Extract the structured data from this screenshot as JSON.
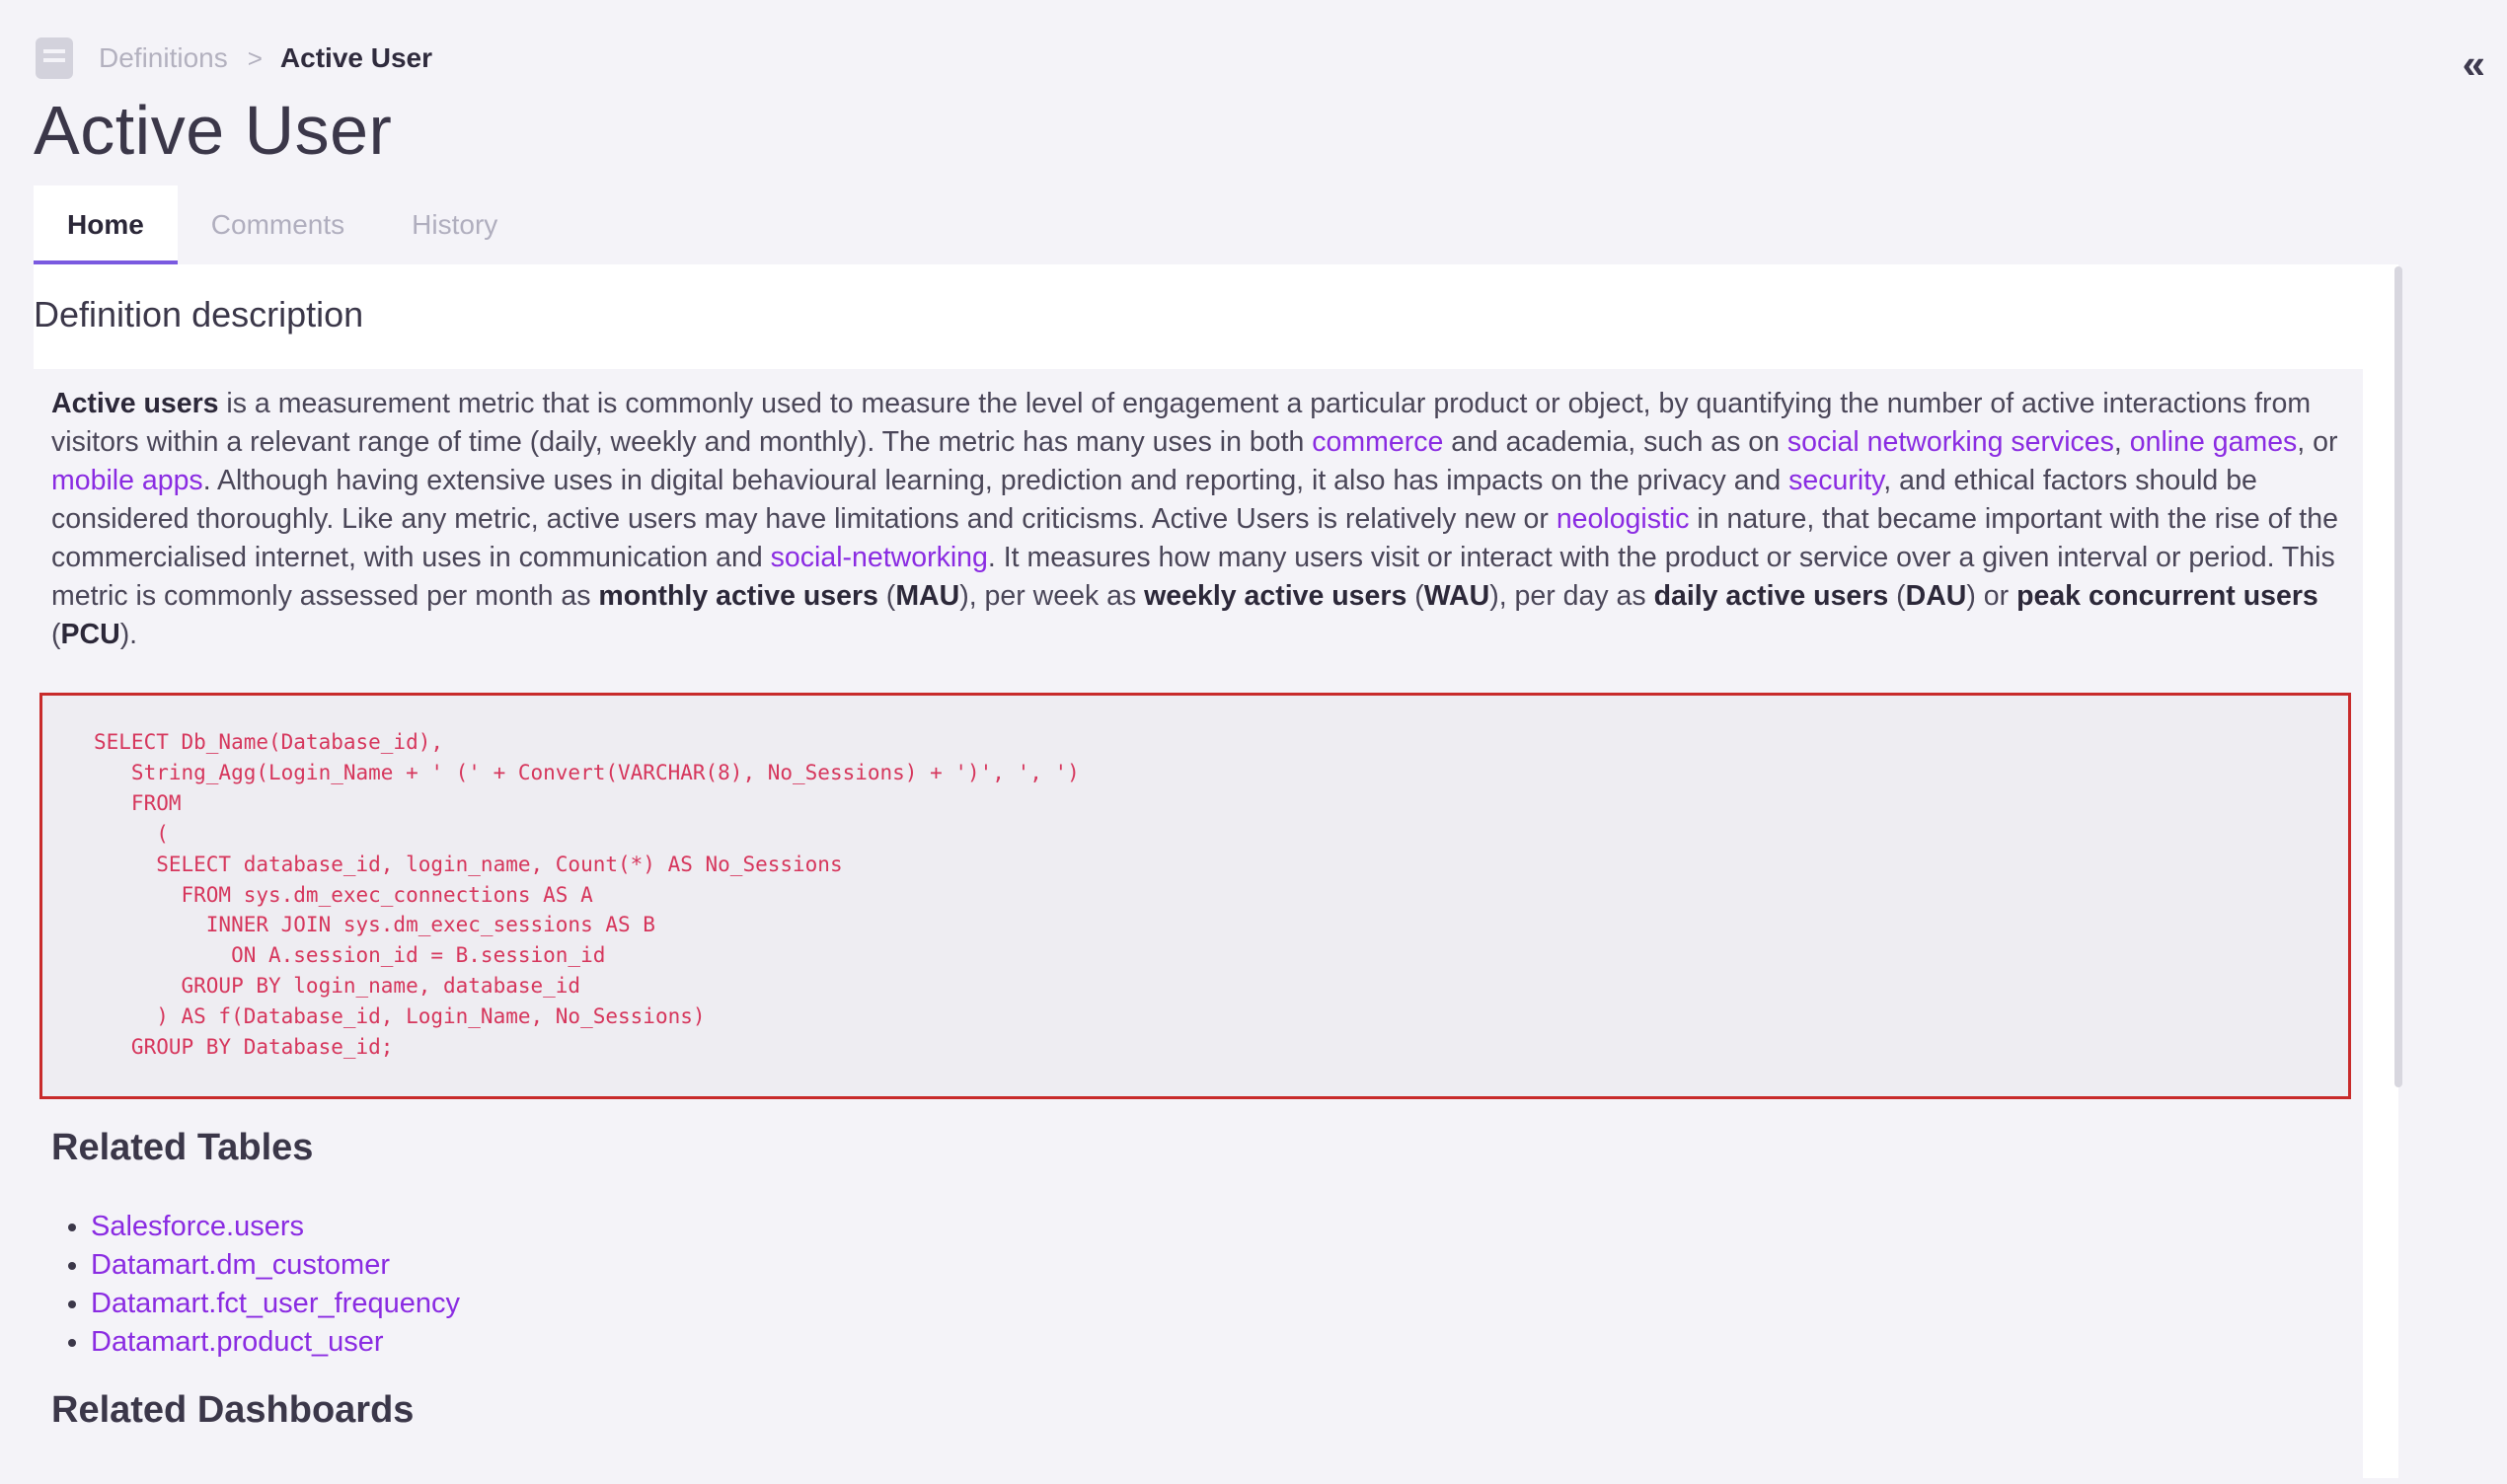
{
  "breadcrumb": {
    "parent": "Definitions",
    "separator": ">",
    "current": "Active User"
  },
  "icons": {
    "breadcrumb": "document-icon",
    "collapse": "collapse-double-chevron-left-icon"
  },
  "collapse_glyph": "«",
  "page_title": "Active User",
  "tabs": [
    {
      "label": "Home",
      "active": true
    },
    {
      "label": "Comments",
      "active": false
    },
    {
      "label": "History",
      "active": false
    }
  ],
  "section_title": "Definition description",
  "description": [
    {
      "t": "Active users",
      "s": "b"
    },
    {
      "t": " is a measurement metric that is commonly used to measure the level of engagement a particular product or object, by quantifying the number of active interactions from visitors within a relevant range of time (daily, weekly and monthly). The metric has many uses in both "
    },
    {
      "t": "commerce",
      "s": "a"
    },
    {
      "t": " and academia, such as on "
    },
    {
      "t": "social networking services",
      "s": "a"
    },
    {
      "t": ", "
    },
    {
      "t": "online games",
      "s": "a"
    },
    {
      "t": ", or "
    },
    {
      "t": "mobile apps",
      "s": "a"
    },
    {
      "t": ". Although having extensive uses in digital behavioural learning, prediction and reporting, it also has impacts on the privacy and "
    },
    {
      "t": "security",
      "s": "a"
    },
    {
      "t": ", and ethical factors should be considered thoroughly. Like any metric, active users may have limitations and criticisms. Active Users is relatively new or "
    },
    {
      "t": "neologistic",
      "s": "a"
    },
    {
      "t": " in nature, that became important with the rise of the commercialised internet, with uses in communication and "
    },
    {
      "t": "social-networking",
      "s": "a"
    },
    {
      "t": ". It measures how many users visit or interact with the product or service over a given interval or period. This metric is commonly assessed per month as "
    },
    {
      "t": "monthly active users",
      "s": "b"
    },
    {
      "t": " ("
    },
    {
      "t": "MAU",
      "s": "b"
    },
    {
      "t": "), per week as "
    },
    {
      "t": "weekly active users",
      "s": "b"
    },
    {
      "t": " ("
    },
    {
      "t": "WAU",
      "s": "b"
    },
    {
      "t": "), per day as "
    },
    {
      "t": "daily active users",
      "s": "b"
    },
    {
      "t": " ("
    },
    {
      "t": "DAU",
      "s": "b"
    },
    {
      "t": ") or "
    },
    {
      "t": "peak concurrent users",
      "s": "b"
    },
    {
      "t": " ("
    },
    {
      "t": "PCU",
      "s": "b"
    },
    {
      "t": ")."
    }
  ],
  "sql_code": "SELECT Db_Name(Database_id),\n   String_Agg(Login_Name + ' (' + Convert(VARCHAR(8), No_Sessions) + ')', ', ')\n   FROM\n     (\n     SELECT database_id, login_name, Count(*) AS No_Sessions\n       FROM sys.dm_exec_connections AS A\n         INNER JOIN sys.dm_exec_sessions AS B\n           ON A.session_id = B.session_id\n       GROUP BY login_name, database_id\n     ) AS f(Database_id, Login_Name, No_Sessions)\n   GROUP BY Database_id;",
  "related_tables": {
    "title": "Related Tables",
    "items": [
      "Salesforce.users",
      "Datamart.dm_customer",
      "Datamart.fct_user_frequency",
      "Datamart.product_user"
    ]
  },
  "related_dashboards": {
    "title": "Related Dashboards"
  },
  "colors": {
    "link": "#8a2be2",
    "tab_indicator": "#7a5ae0",
    "code_text": "#d6365c",
    "code_border": "#c82b2b"
  }
}
